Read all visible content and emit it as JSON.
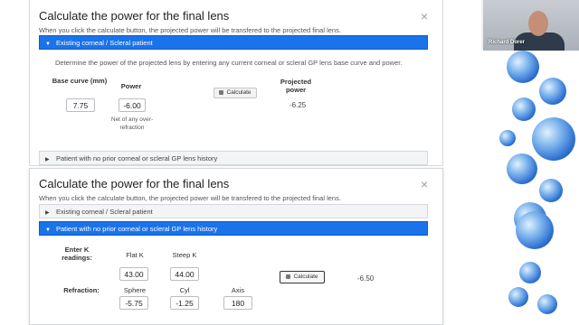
{
  "panel1": {
    "title": "Calculate the power for the final lens",
    "close": "×",
    "subtitle": "When you click the calculate button, the projected power will be transfered to the projected final lens.",
    "accordion_active": "Existing corneal / Scleral patient",
    "description": "Determine the power of the projected lens by entering any current corneal or scleral GP lens base curve and power.",
    "base_curve_label": "Base curve (mm)",
    "base_curve_value": "7.75",
    "power_label": "Power",
    "power_value": "-6.00",
    "power_note": "Net of any over-refraction",
    "calculate_label": "Calculate",
    "projected_power_label": "Projected power",
    "projected_power_value": "-6.25",
    "accordion_collapsed": "Patient with no prior corneal or scleral GP lens history"
  },
  "panel2": {
    "title": "Calculate the power for the final lens",
    "close": "×",
    "subtitle": "When you click the calculate button, the projected power will be transfered to the projected final lens.",
    "accordion_collapsed": "Existing corneal / Scleral patient",
    "accordion_active": "Patient with no prior corneal or scleral GP lens history",
    "enter_k_label": "Enter K readings:",
    "flat_k_label": "Flat K",
    "flat_k_value": "43.00",
    "steep_k_label": "Steep K",
    "steep_k_value": "44.00",
    "refraction_label": "Refraction:",
    "sphere_label": "Sphere",
    "sphere_value": "-5.75",
    "cyl_label": "Cyl",
    "cyl_value": "-1.25",
    "axis_label": "Axis",
    "axis_value": "180",
    "calculate_label": "Calculate",
    "result_value": "-6.50"
  },
  "video": {
    "participant_name": "Richard Dorer"
  },
  "colors": {
    "accent": "#1a73e8",
    "orb": "#2d6fd1"
  },
  "icons": [
    "close-icon",
    "caret-down-icon",
    "caret-right-icon",
    "calculator-icon"
  ]
}
